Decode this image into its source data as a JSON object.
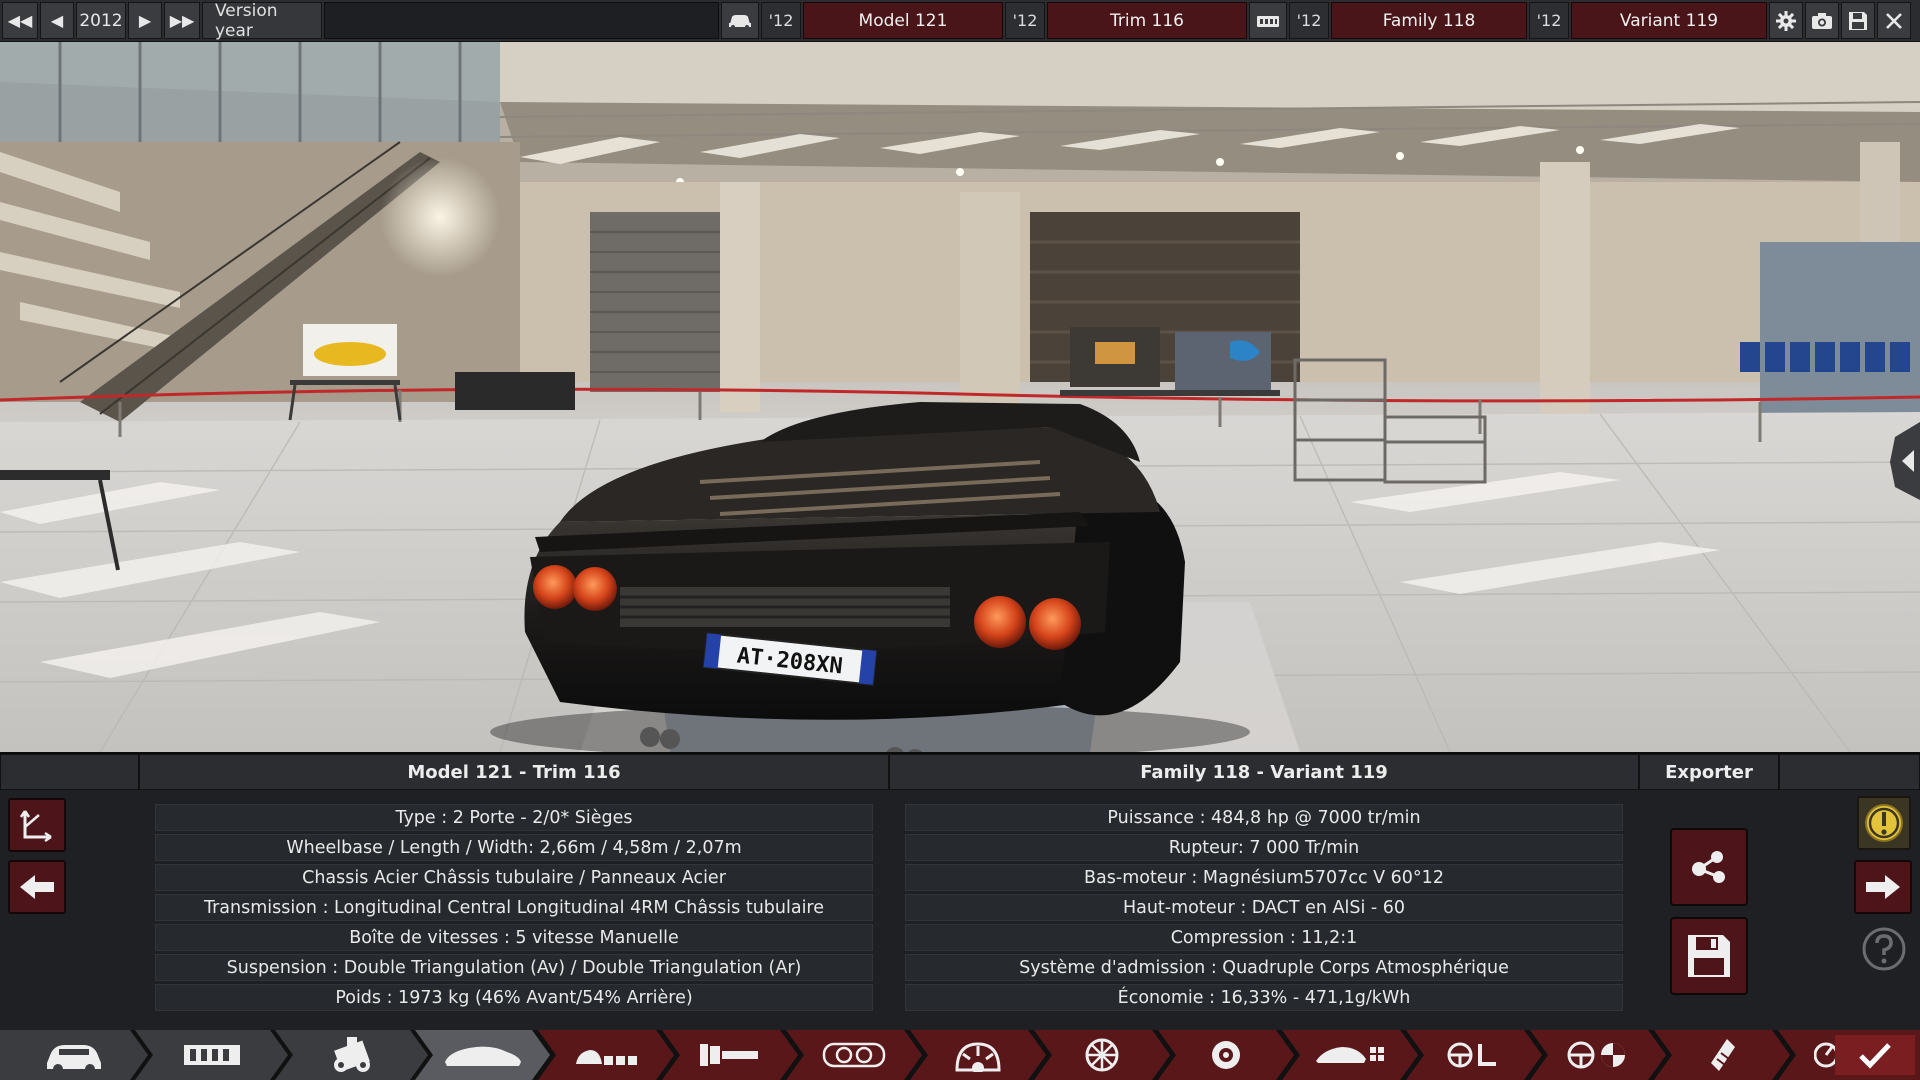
{
  "topbar": {
    "prev_fast_label": "◀◀",
    "prev_label": "◀",
    "year": "2012",
    "next_label": "▶",
    "next_fast_label": "▶▶",
    "version_label": "Version year",
    "model_year": "'12",
    "model_name": "Model 121",
    "trim_year": "'12",
    "trim_name": "Trim 116",
    "family_year": "'12",
    "family_name": "Family 118",
    "variant_year": "'12",
    "variant_name": "Variant 119"
  },
  "viewport": {
    "plate_text": "AT·208XN"
  },
  "left_panel": {
    "title": "Model 121 - Trim 116",
    "rows": [
      "Type : 2 Porte - 2/0* Sièges",
      "Wheelbase / Length / Width: 2,66m / 4,58m / 2,07m",
      "Chassis Acier Châssis tubulaire / Panneaux Acier",
      "Transmission : Longitudinal Central Longitudinal 4RM Châssis tubulaire",
      "Boîte de vitesses : 5 vitesse Manuelle",
      "Suspension : Double Triangulation (Av) / Double Triangulation (Ar)",
      "Poids : 1973 kg (46% Avant/54% Arrière)"
    ]
  },
  "right_panel": {
    "title": "Family 118 - Variant 119",
    "rows": [
      "Puissance : 484,8 hp @ 7000 tr/min",
      "Rupteur: 7 000 Tr/min",
      "Bas-moteur : Magnésium5707cc V 60°12",
      "Haut-moteur : DACT en AlSi - 60",
      "Compression : 11,2:1",
      "Système d'admission : Quadruple Corps Atmosphérique",
      "Économie : 16,33% - 471,1g/kWh"
    ]
  },
  "export_panel": {
    "title": "Exporter"
  },
  "colors": {
    "accent_red": "#4d1519",
    "panel_bg": "#1e2023",
    "warning_yellow": "#e3c33a"
  },
  "icons": {
    "toolbar": [
      "car-body-icon",
      "chassis-icon",
      "engine-icon",
      "body-shape-icon",
      "trim-icon",
      "fixtures-icon",
      "interior-icon",
      "suspension-icon",
      "wheels-icon",
      "brakes-icon",
      "aero-icon",
      "driveability-icon",
      "safety-icon",
      "fuel-icon",
      "testing-icon",
      "confirm-icon"
    ]
  }
}
